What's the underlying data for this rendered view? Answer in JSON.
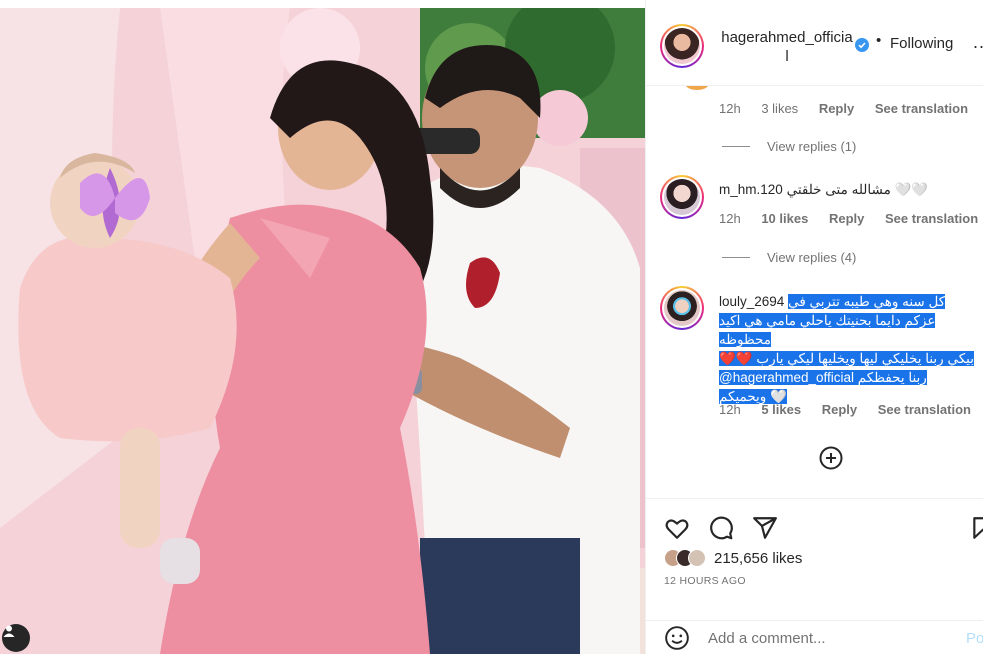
{
  "post": {
    "photo_alt": "",
    "header": {
      "username": "hagerahmed_official",
      "following_label": "Following",
      "dot": "•",
      "more": "..."
    },
    "comments": [
      {
        "text_fragment": "",
        "time": "12h",
        "likes": "3 likes",
        "reply": "Reply",
        "translate": "See translation",
        "view_replies": "View replies (1)"
      },
      {
        "user": "m_hm.120",
        "text": "مشالله متى خلقتي 🤍🤍",
        "time": "12h",
        "likes": "10 likes",
        "reply": "Reply",
        "translate": "See translation",
        "view_replies": "View replies (4)"
      },
      {
        "user": "louly_2694",
        "line1": "كل سنه وهي طيبه تتربي في",
        "line2": "عزكم دايما بحنيتك ياحلي مامي هي اكيد محظوظه",
        "line3": "❤️❤️ بيكي ربنا يخليكي ليها ويخليها ليكي يارب",
        "line4": "@hagerahmed_official ربنا يحفظكم",
        "line5": "ويحميكم 🤍",
        "time": "12h",
        "likes": "5 likes",
        "reply": "Reply",
        "translate": "See translation"
      }
    ],
    "likes_count": "215,656 likes",
    "time_ago": "12 HOURS AGO",
    "add_comment_placeholder": "Add a comment...",
    "post_button": "Po"
  },
  "colors": {
    "verified": "#3897f0",
    "highlight": "#1a73e8",
    "post_disabled": "#b2dffc"
  }
}
